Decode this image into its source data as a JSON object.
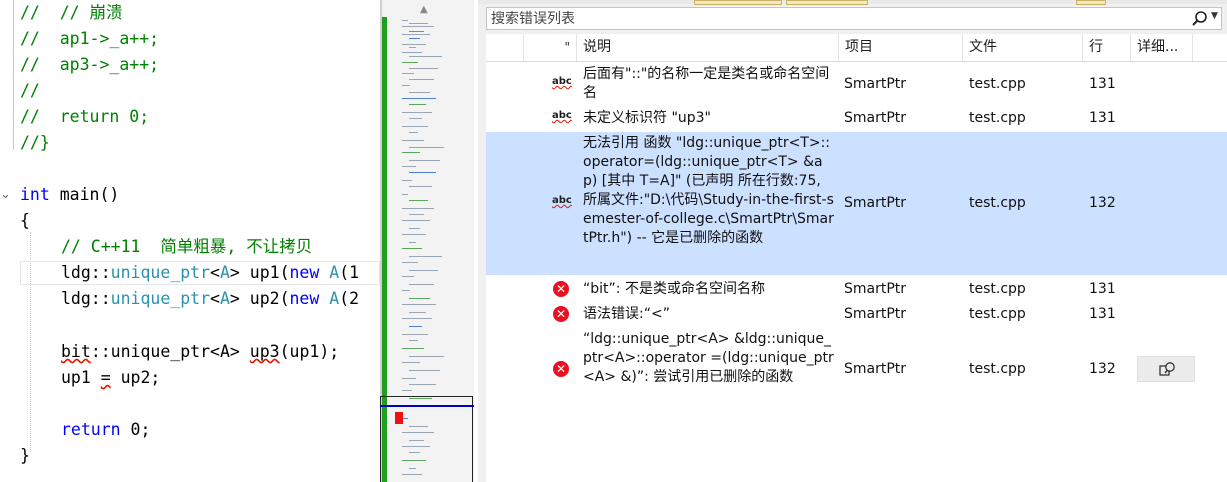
{
  "editor": {
    "lines": {
      "l1": "//  // 崩溃",
      "l2": "//  ap1->_a++;",
      "l3": "//  ap3->_a++;",
      "l4": "//",
      "l5": "//  return 0;",
      "l6": "//}",
      "main_kw": "int",
      "main_rest": " main()",
      "open_brace": "{",
      "comment": "// C++11  简单粗暴, 不让拷贝",
      "up1_ns": "ldg::",
      "up1_type": "unique_ptr",
      "up1_lt": "<",
      "up1_A": "A",
      "up1_gt": ">",
      "up1_name": " up1(",
      "up1_new": "new",
      "up1_space": " ",
      "up1_A2": "A",
      "up1_tail": "(1",
      "up2_ns": "ldg::",
      "up2_type": "unique_ptr",
      "up2_lt": "<",
      "up2_A": "A",
      "up2_gt": ">",
      "up2_name": " up2(",
      "up2_new": "new",
      "up2_space": " ",
      "up2_A2": "A",
      "up2_tail": "(2",
      "bit_ns": "bit",
      "bit_rest": "::unique_ptr<A> ",
      "bit_up3": "up3",
      "bit_tail": "(up1);",
      "assign_a": "up1 ",
      "assign_eq": "=",
      "assign_b": " up2;",
      "ret_kw": "return",
      "ret_rest": " 0;",
      "close_brace": "}"
    }
  },
  "error_list": {
    "search_placeholder": "搜索错误列表",
    "columns": {
      "code": "\"",
      "description": "说明",
      "project": "项目",
      "file": "文件",
      "line": "行",
      "details": "详细..."
    },
    "rows": [
      {
        "icon": "abc",
        "description": "后面有\"::\"的名称一定是类名或命名空间名",
        "project": "SmartPtr",
        "file": "test.cpp",
        "line": "131"
      },
      {
        "icon": "abc",
        "description": "未定义标识符 \"up3\"",
        "project": "SmartPtr",
        "file": "test.cpp",
        "line": "131"
      },
      {
        "icon": "abc",
        "description": "无法引用 函数 \"ldg::unique_ptr<T>::operator=(ldg::unique_ptr<T> &ap) [其中 T=A]\" (已声明 所在行数:75, 所属文件:\"D:\\代码\\Study-in-the-first-semester-of-college.c\\SmartPtr\\SmartPtr.h\") -- 它是已删除的函数",
        "project": "SmartPtr",
        "file": "test.cpp",
        "line": "132"
      },
      {
        "icon": "x",
        "description": "“bit”: 不是类或命名空间名称",
        "project": "SmartPtr",
        "file": "test.cpp",
        "line": "131"
      },
      {
        "icon": "x",
        "description": "语法错误:“<”",
        "project": "SmartPtr",
        "file": "test.cpp",
        "line": "131"
      },
      {
        "icon": "x",
        "description": "“ldg::unique_ptr<A> &ldg::unique_ptr<A>::operator =(ldg::unique_ptr<A> &)”: 尝试引用已删除的函数",
        "project": "SmartPtr",
        "file": "test.cpp",
        "line": "132"
      }
    ],
    "row_icons": {
      "code_analysis": "abc",
      "error": "✕"
    }
  }
}
